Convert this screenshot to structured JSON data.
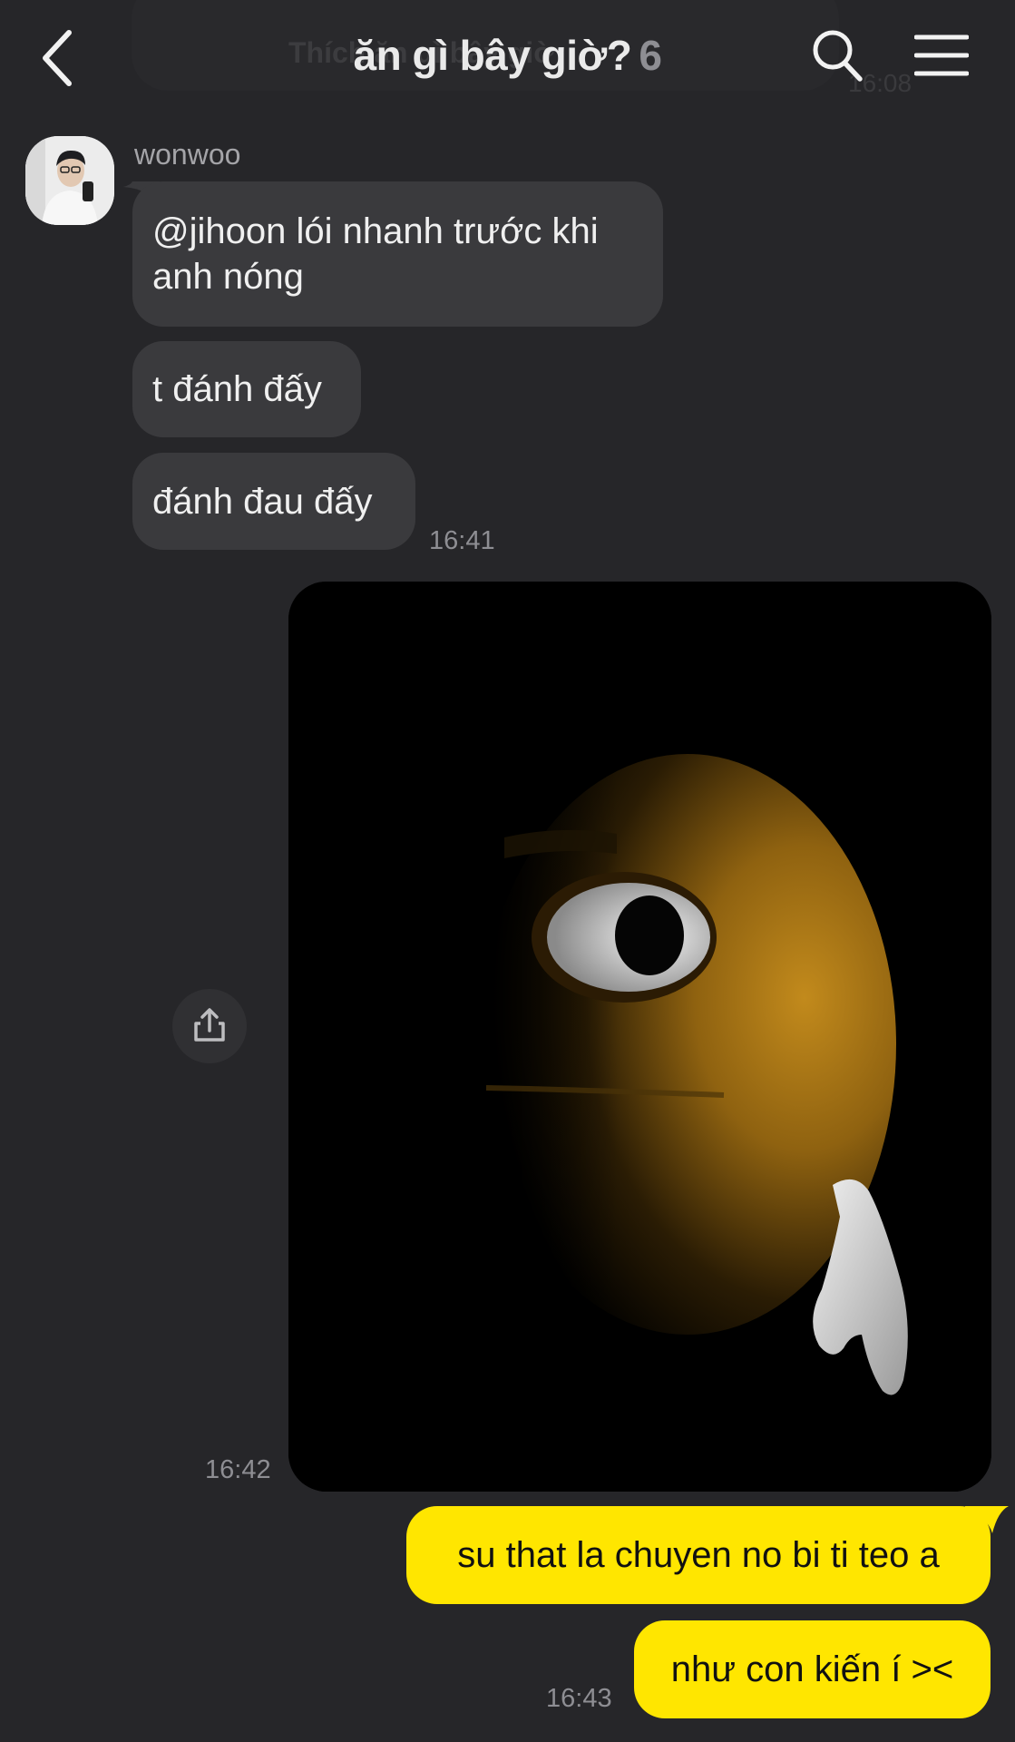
{
  "header": {
    "ghost_title": "Thích ăn gì bây giờ",
    "ghost_time": "16:08",
    "title": "ăn gì bây giờ?",
    "member_count": "6"
  },
  "icons": {
    "back": "chevron-left-icon",
    "search": "search-icon",
    "menu": "hamburger-menu-icon",
    "share": "share-icon"
  },
  "messages": {
    "incoming": {
      "sender": "wonwoo",
      "texts": [
        "@jihoon lói nhanh trước khi anh nóng",
        "t đánh đấy",
        "đánh đau đấy"
      ],
      "time": "16:41"
    },
    "image_message": {
      "time": "16:42"
    },
    "outgoing": {
      "texts": [
        "su that la chuyen no bi ti teo a",
        "như con kiến í ><"
      ],
      "time": "16:43"
    }
  },
  "colors": {
    "background": "#262629",
    "incoming_bubble": "#3a3a3d",
    "outgoing_bubble": "#ffe600",
    "muted_text": "#8e8e93"
  }
}
